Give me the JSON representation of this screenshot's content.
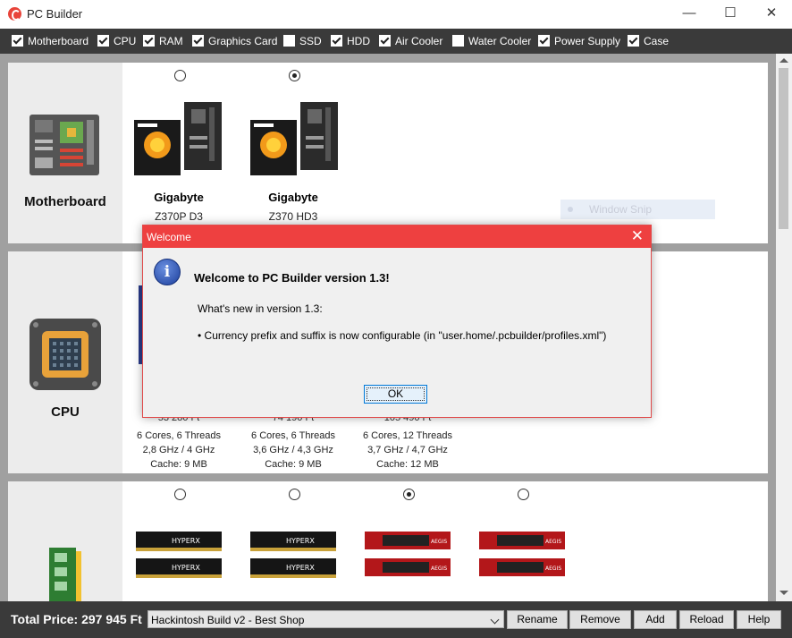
{
  "window": {
    "title": "PC Builder",
    "minimize": "—",
    "maximize": "☐",
    "close": "✕"
  },
  "filters": [
    {
      "label": "Motherboard",
      "checked": true
    },
    {
      "label": "CPU",
      "checked": true
    },
    {
      "label": "RAM",
      "checked": true
    },
    {
      "label": "Graphics Card",
      "checked": true
    },
    {
      "label": "SSD",
      "checked": false
    },
    {
      "label": "HDD",
      "checked": true
    },
    {
      "label": "Air Cooler",
      "checked": true
    },
    {
      "label": "Water Cooler",
      "checked": false
    },
    {
      "label": "Power Supply",
      "checked": true
    },
    {
      "label": "Case",
      "checked": true
    }
  ],
  "sections": {
    "motherboard": {
      "label": "Motherboard",
      "items": [
        {
          "brand": "Gigabyte",
          "model": "Z370P D3",
          "selected": false,
          "box_text": "Z370P D3"
        },
        {
          "brand": "Gigabyte",
          "model": "Z370 HD3",
          "selected": true,
          "box_text": "Z370 HD3"
        }
      ]
    },
    "cpu": {
      "label": "CPU",
      "items": [
        {
          "price": "53 280 Ft",
          "cores": "6 Cores, 6 Threads",
          "clock": "2,8 GHz / 4 GHz",
          "cache": "Cache: 9 MB"
        },
        {
          "price": "74 190 Ft",
          "cores": "6 Cores, 6 Threads",
          "clock": "3,6 GHz / 4,3 GHz",
          "cache": "Cache: 9 MB"
        },
        {
          "price": "105 490 Ft",
          "cores": "6 Cores, 12 Threads",
          "clock": "3,7 GHz / 4,7 GHz",
          "cache": "Cache: 12 MB"
        }
      ]
    },
    "ram": {
      "items": [
        {
          "brand_text": "HYPERX",
          "selected": false
        },
        {
          "brand_text": "HYPERX",
          "selected": false
        },
        {
          "brand_text": "AEGIS",
          "selected": true
        },
        {
          "brand_text": "AEGIS",
          "selected": false
        }
      ]
    }
  },
  "bottom": {
    "total": "Total Price: 297 945 Ft",
    "profile": "Hackintosh Build v2 - Best Shop",
    "buttons": [
      "Rename",
      "Remove",
      "Add",
      "Reload",
      "Help"
    ]
  },
  "dialog": {
    "title": "Welcome",
    "close": "✕",
    "icon": "i",
    "heading": "Welcome to PC Builder version 1.3!",
    "whats_new": "What's new in version 1.3:",
    "bullet": "• Currency prefix and suffix is now configurable (in \"user.home/.pcbuilder/profiles.xml\")",
    "ok": "OK"
  },
  "ghost_tooltip": "Window Snip",
  "colors": {
    "dialog_title": "#ee4040",
    "toolbar": "#3a3a3a"
  }
}
